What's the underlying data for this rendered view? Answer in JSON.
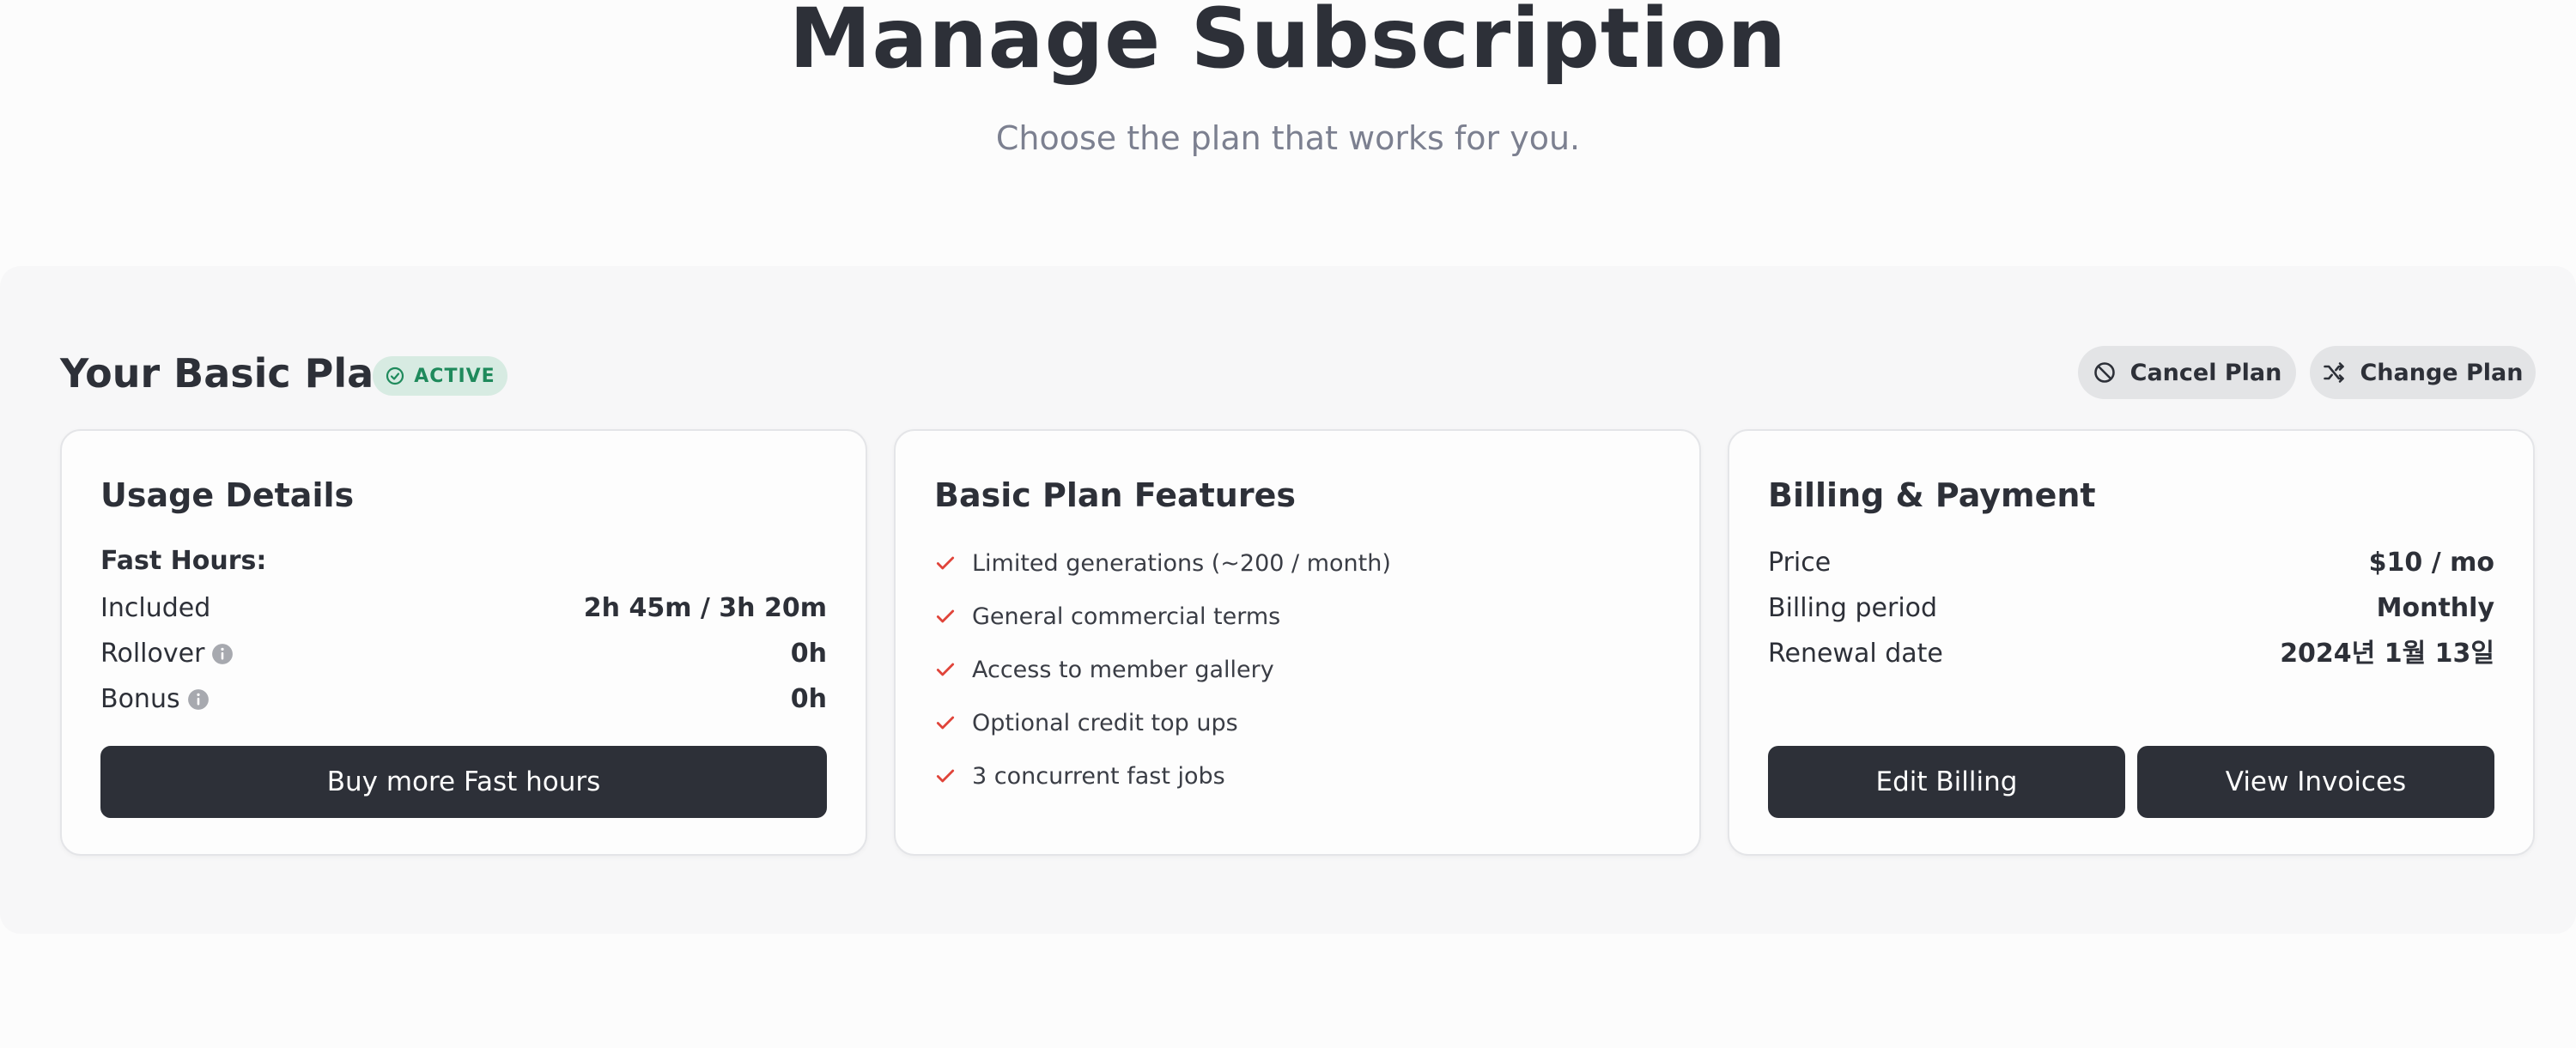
{
  "header": {
    "title": "Manage Subscription",
    "subtitle": "Choose the plan that works for you."
  },
  "plan": {
    "title": "Your Basic Plan",
    "status_badge": "ACTIVE",
    "cancel_label": "Cancel Plan",
    "change_label": "Change Plan"
  },
  "usage": {
    "title": "Usage Details",
    "fast_hours_label": "Fast Hours:",
    "rows": [
      {
        "label": "Included",
        "value": "2h 45m / 3h 20m"
      },
      {
        "label": "Rollover",
        "value": "0h"
      },
      {
        "label": "Bonus",
        "value": "0h"
      }
    ],
    "buy_label": "Buy more Fast hours"
  },
  "features": {
    "title": "Basic Plan Features",
    "items": [
      "Limited generations (~200 / month)",
      "General commercial terms",
      "Access to member gallery",
      "Optional credit top ups",
      "3 concurrent fast jobs"
    ]
  },
  "billing": {
    "title": "Billing & Payment",
    "rows": [
      {
        "label": "Price",
        "value": "$10 / mo"
      },
      {
        "label": "Billing period",
        "value": "Monthly"
      },
      {
        "label": "Renewal date",
        "value": "2024년 1월 13일"
      }
    ],
    "edit_label": "Edit Billing",
    "invoices_label": "View Invoices"
  },
  "colors": {
    "primary_dark": "#2d3038",
    "badge_bg": "#d7ebe2",
    "badge_text": "#1f8a5c",
    "check_red": "#e0443a",
    "muted_text": "#7c8090"
  },
  "icons": {
    "badge": "check-circle-icon",
    "cancel": "ban-icon",
    "change": "shuffle-icon",
    "info": "info-icon",
    "feature": "check-icon"
  }
}
